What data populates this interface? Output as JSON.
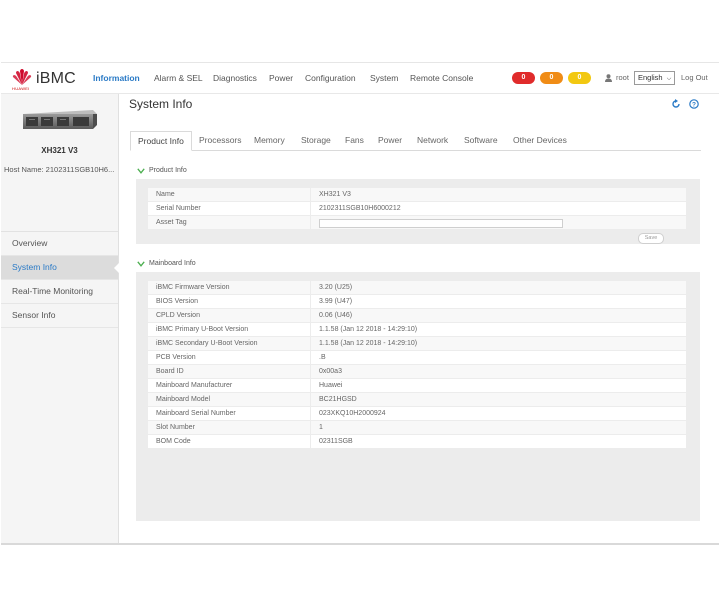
{
  "app": {
    "brand": "iBMC",
    "vendor": "HUAWEI",
    "brand_color": "#cf0a2c",
    "accent": "#2a7ac6"
  },
  "nav": {
    "items": [
      {
        "label": "Information",
        "active": true
      },
      {
        "label": "Alarm & SEL"
      },
      {
        "label": "Diagnostics"
      },
      {
        "label": "Power"
      },
      {
        "label": "Configuration"
      },
      {
        "label": "System"
      },
      {
        "label": "Remote Console"
      }
    ],
    "alarms": [
      {
        "count": "0",
        "level": "critical",
        "color": "#e02b2b"
      },
      {
        "count": "0",
        "level": "major",
        "color": "#f08c16"
      },
      {
        "count": "0",
        "level": "minor",
        "color": "#f2c811"
      }
    ],
    "user": "root",
    "user_icon": "user-icon",
    "language": "English",
    "logout": "Log Out"
  },
  "sidebar": {
    "model": "XH321 V3",
    "host_name": "Host Name: 2102311SGB10H6...",
    "menu": [
      {
        "label": "Overview"
      },
      {
        "label": "System Info",
        "active": true
      },
      {
        "label": "Real-Time Monitoring"
      },
      {
        "label": "Sensor Info"
      }
    ]
  },
  "main": {
    "title": "System Info",
    "refresh_icon": "refresh-icon",
    "help_icon": "help-icon",
    "tabs": [
      {
        "label": "Product Info",
        "active": true
      },
      {
        "label": "Processors"
      },
      {
        "label": "Memory"
      },
      {
        "label": "Storage"
      },
      {
        "label": "Fans"
      },
      {
        "label": "Power"
      },
      {
        "label": "Network"
      },
      {
        "label": "Software"
      },
      {
        "label": "Other Devices"
      }
    ],
    "product_info": {
      "title": "Product Info",
      "rows": [
        {
          "label": "Name",
          "value": "XH321 V3"
        },
        {
          "label": "Serial Number",
          "value": "2102311SGB10H6000212"
        }
      ],
      "asset_tag": {
        "label": "Asset Tag",
        "value": ""
      },
      "save_label": "Save"
    },
    "mainboard_info": {
      "title": "Mainboard Info",
      "rows": [
        {
          "label": "iBMC Firmware Version",
          "value": "3.20 (U25)"
        },
        {
          "label": "BIOS Version",
          "value": "3.99 (U47)"
        },
        {
          "label": "CPLD Version",
          "value": "0.06 (U46)"
        },
        {
          "label": "iBMC Primary U-Boot Version",
          "value": "1.1.58 (Jan 12 2018 - 14:29:10)"
        },
        {
          "label": "iBMC Secondary U-Boot Version",
          "value": "1.1.58 (Jan 12 2018 - 14:29:10)"
        },
        {
          "label": "PCB Version",
          "value": ".B"
        },
        {
          "label": "Board ID",
          "value": "0x00a3"
        },
        {
          "label": "Mainboard Manufacturer",
          "value": "Huawei"
        },
        {
          "label": "Mainboard Model",
          "value": "BC21HGSD"
        },
        {
          "label": "Mainboard Serial Number",
          "value": "023XKQ10H2000924"
        },
        {
          "label": "Slot Number",
          "value": "1"
        },
        {
          "label": "BOM Code",
          "value": "02311SGB"
        }
      ]
    }
  }
}
